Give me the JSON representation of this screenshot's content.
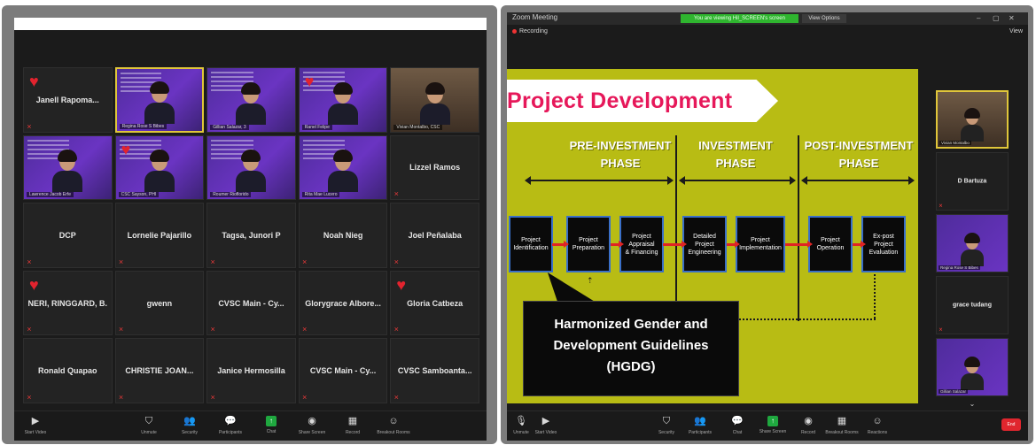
{
  "left_window": {
    "grid": [
      {
        "name": "Janell Rapoma...",
        "type": "name",
        "heart": true,
        "muted": true
      },
      {
        "name": "",
        "type": "video",
        "label": "Regina Rose S Bibes",
        "active": true
      },
      {
        "name": "",
        "type": "video",
        "label": "Gillian Salazar, 3"
      },
      {
        "name": "",
        "type": "video",
        "label": "Ranel Felipe",
        "heart": true
      },
      {
        "name": "",
        "type": "office",
        "label": "Vivian Montalbo, CSC"
      },
      {
        "name": "",
        "type": "video",
        "label": "Lawrence Jacob Erfe"
      },
      {
        "name": "",
        "type": "video",
        "label": "CSC Sayson, PHI",
        "heart": true
      },
      {
        "name": "",
        "type": "video",
        "label": "Roumer Rioflorido"
      },
      {
        "name": "",
        "type": "video",
        "label": "Rita Mae Lucero"
      },
      {
        "name": "Lizzel Ramos",
        "type": "name",
        "muted": true
      },
      {
        "name": "DCP",
        "type": "name",
        "muted": true
      },
      {
        "name": "Lornelie Pajarillo",
        "type": "name",
        "muted": true
      },
      {
        "name": "Tagsa, Junori P",
        "type": "name",
        "muted": true
      },
      {
        "name": "Noah Nieg",
        "type": "name",
        "muted": true
      },
      {
        "name": "Joel Peñalaba",
        "type": "name",
        "muted": true
      },
      {
        "name": "NERI, RINGGARD, B.",
        "type": "name",
        "heart": true,
        "muted": true
      },
      {
        "name": "gwenn",
        "type": "name",
        "muted": true
      },
      {
        "name": "CVSC Main - Cy...",
        "type": "name",
        "muted": true
      },
      {
        "name": "Glorygrace Albore...",
        "type": "name",
        "muted": true
      },
      {
        "name": "Gloria Catbeza",
        "type": "name",
        "heart": true,
        "muted": true
      },
      {
        "name": "Ronald Quapao",
        "type": "name",
        "muted": true
      },
      {
        "name": "CHRISTIE JOAN...",
        "type": "name",
        "muted": true
      },
      {
        "name": "Janice Hermosilla",
        "type": "name",
        "muted": true
      },
      {
        "name": "CVSC Main - Cy...",
        "type": "name",
        "muted": true
      },
      {
        "name": "CVSC Samboanta...",
        "type": "name",
        "muted": true
      }
    ],
    "toolbar": [
      {
        "icon": "microphone-icon",
        "glyph": "🎙",
        "label": "Unmute"
      },
      {
        "icon": "shield-icon",
        "glyph": "⛉",
        "label": "Security"
      },
      {
        "icon": "participants-icon",
        "glyph": "👥",
        "label": "Participants"
      },
      {
        "icon": "chat-icon",
        "glyph": "💬",
        "label": "Chat"
      },
      {
        "icon": "share-screen-icon",
        "glyph": "↑",
        "label": "Share Screen"
      },
      {
        "icon": "record-icon",
        "glyph": "◉",
        "label": "Record"
      },
      {
        "icon": "breakout-rooms-icon",
        "glyph": "▦",
        "label": "Breakout Rooms"
      },
      {
        "icon": "reactions-icon",
        "glyph": "☺",
        "label": "Reactions"
      }
    ],
    "stop_video_label": "Start Video"
  },
  "right_window": {
    "title": "Zoom Meeting",
    "banner": "You are viewing Hil_SCREEN's screen",
    "speaker": "View Options",
    "recording": "Recording",
    "view": "View",
    "slide": {
      "title": "Project  Development",
      "phases": [
        "PRE-INVESTMENT\nPHASE",
        "INVESTMENT\nPHASE",
        "POST-INVESTMENT\nPHASE"
      ],
      "boxes": [
        "Project\nIdentification",
        "Project\nPreparation",
        "Project\nAppraisal\n& Financing",
        "Detailed\nProject\nEngineering",
        "Project\nImplementation",
        "Project\nOperation",
        "Ex-post\nProject\nEvaluation"
      ],
      "callout": "Harmonized Gender and\nDevelopment Guidelines\n(HGDG)"
    },
    "side": [
      {
        "type": "office",
        "label": "Vivian Montalbo"
      },
      {
        "type": "name",
        "name": "D Bartuza"
      },
      {
        "type": "video",
        "label": "Regina Rose S Bibes"
      },
      {
        "type": "name",
        "name": "grace tudang"
      },
      {
        "type": "video",
        "label": "Gillian Salazar"
      }
    ],
    "side_more": "⌄",
    "toolbar": [
      {
        "icon": "microphone-icon",
        "glyph": "🎙",
        "label": "Unmute"
      },
      {
        "icon": "video-icon",
        "glyph": "▶",
        "label": "Start Video"
      },
      {
        "icon": "shield-icon",
        "glyph": "⛉",
        "label": "Security"
      },
      {
        "icon": "participants-icon",
        "glyph": "👥",
        "label": "Participants"
      },
      {
        "icon": "chat-icon",
        "glyph": "💬",
        "label": "Chat"
      },
      {
        "icon": "share-screen-icon",
        "glyph": "↑",
        "label": "Share Screen"
      },
      {
        "icon": "record-icon",
        "glyph": "◉",
        "label": "Record"
      },
      {
        "icon": "breakout-rooms-icon",
        "glyph": "▦",
        "label": "Breakout Rooms"
      },
      {
        "icon": "reactions-icon",
        "glyph": "☺",
        "label": "Reactions"
      }
    ],
    "end_label": "End"
  },
  "colors": {
    "slide_bg": "#b8bc14",
    "title_pink": "#e6185a",
    "share_green": "#1fa83f",
    "end_red": "#e0262e",
    "heart": "#e2232e"
  }
}
